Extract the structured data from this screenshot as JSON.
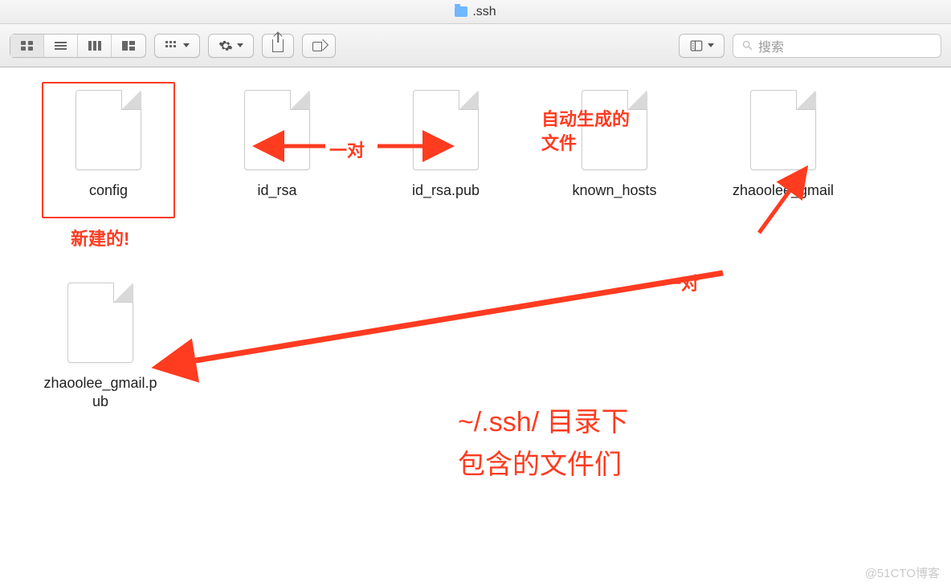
{
  "title": ".ssh",
  "toolbar": {
    "search_placeholder": "搜索"
  },
  "files": [
    {
      "name": "config"
    },
    {
      "name": "id_rsa"
    },
    {
      "name": "id_rsa.pub"
    },
    {
      "name": "known_hosts"
    },
    {
      "name": "zhaoolee_gmail"
    },
    {
      "name": "zhaoolee_gmail.p\nub"
    }
  ],
  "annotations": {
    "new_note": "新建的!",
    "pair1": "一对",
    "auto_gen": "自动生成的\n文件",
    "pair2": "一对",
    "caption": "~/.ssh/ 目录下\n包含的文件们"
  },
  "watermark": "@51CTO博客",
  "colors": {
    "accent": "#ff3b20"
  }
}
